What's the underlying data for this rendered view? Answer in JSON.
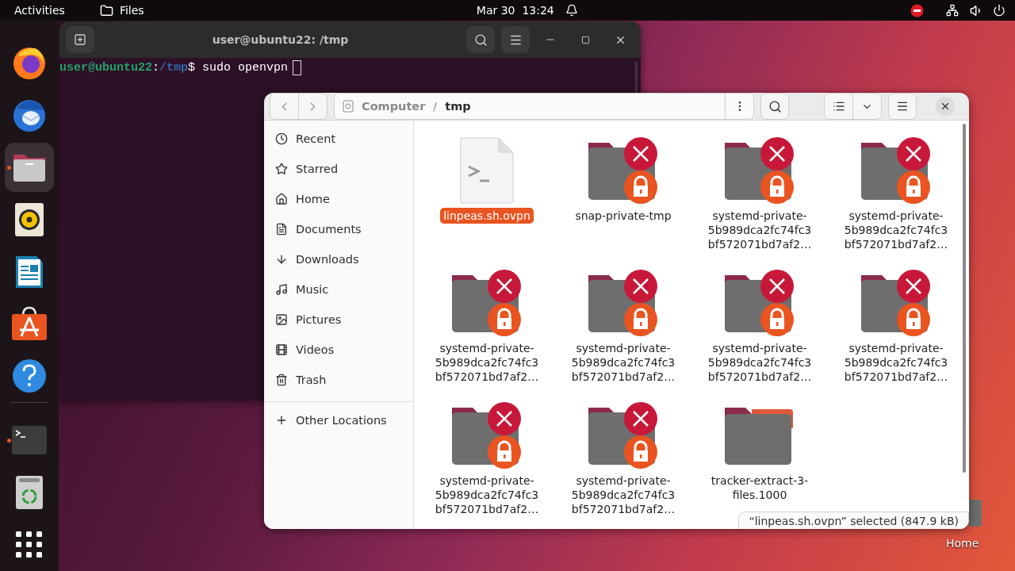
{
  "top_bar": {
    "activities": "Activities",
    "app_menu": "Files",
    "clock": "Mar 30  13:24"
  },
  "dock": {
    "favorites": [
      {
        "kind": "firefox",
        "running": false,
        "selected": false
      },
      {
        "kind": "mail",
        "running": false,
        "selected": false
      },
      {
        "kind": "files",
        "running": true,
        "selected": true
      },
      {
        "kind": "music",
        "running": false,
        "selected": false
      },
      {
        "kind": "writer",
        "running": false,
        "selected": false
      },
      {
        "kind": "store",
        "running": false,
        "selected": false
      },
      {
        "kind": "help",
        "running": false,
        "selected": false
      }
    ],
    "others": [
      {
        "kind": "terminal",
        "running": true,
        "selected": false
      },
      {
        "kind": "trash",
        "running": false,
        "selected": false
      },
      {
        "kind": "apps",
        "running": false,
        "selected": false
      }
    ]
  },
  "terminal": {
    "title": "user@ubuntu22: /tmp",
    "prompt": {
      "user": "user@ubuntu22",
      "colon": ":",
      "path": "/tmp",
      "dollar": "$",
      "command": " sudo openvpn"
    }
  },
  "files": {
    "path_bar": {
      "separator": "/",
      "segments": [
        {
          "label": "Computer",
          "selected": false
        },
        {
          "label": "tmp",
          "selected": true
        }
      ]
    },
    "sidebar": {
      "places": [
        {
          "label": "Recent"
        },
        {
          "label": "Starred"
        },
        {
          "label": "Home"
        },
        {
          "label": "Documents"
        },
        {
          "label": "Downloads"
        },
        {
          "label": "Music"
        },
        {
          "label": "Pictures"
        },
        {
          "label": "Videos"
        },
        {
          "label": "Trash"
        }
      ],
      "other": "Other Locations"
    },
    "items": [
      {
        "kind": "script",
        "selected": true,
        "lines": [
          "linpeas.sh.ovpn"
        ]
      },
      {
        "kind": "locked-folder",
        "selected": false,
        "lines": [
          "snap-private-tmp"
        ]
      },
      {
        "kind": "locked-folder",
        "selected": false,
        "lines": [
          "systemd-private-",
          "5b989dca2fc74fc3",
          "bf572071bd7af2…"
        ]
      },
      {
        "kind": "locked-folder",
        "selected": false,
        "lines": [
          "systemd-private-",
          "5b989dca2fc74fc3",
          "bf572071bd7af2…"
        ]
      },
      {
        "kind": "locked-folder",
        "selected": false,
        "lines": [
          "systemd-private-",
          "5b989dca2fc74fc3",
          "bf572071bd7af2…"
        ]
      },
      {
        "kind": "locked-folder",
        "selected": false,
        "lines": [
          "systemd-private-",
          "5b989dca2fc74fc3",
          "bf572071bd7af2…"
        ]
      },
      {
        "kind": "locked-folder",
        "selected": false,
        "lines": [
          "systemd-private-",
          "5b989dca2fc74fc3",
          "bf572071bd7af2…"
        ]
      },
      {
        "kind": "locked-folder",
        "selected": false,
        "lines": [
          "systemd-private-",
          "5b989dca2fc74fc3",
          "bf572071bd7af2…"
        ]
      },
      {
        "kind": "locked-folder",
        "selected": false,
        "lines": [
          "systemd-private-",
          "5b989dca2fc74fc3",
          "bf572071bd7af2…"
        ]
      },
      {
        "kind": "locked-folder",
        "selected": false,
        "lines": [
          "systemd-private-",
          "5b989dca2fc74fc3",
          "bf572071bd7af2…"
        ]
      },
      {
        "kind": "folder",
        "selected": false,
        "lines": [
          "tracker-extract-3-",
          "files.1000"
        ]
      }
    ],
    "status": "“linpeas.sh.ovpn” selected (847.9 kB)"
  },
  "desktop": {
    "icons": [
      {
        "label": "Home"
      }
    ]
  }
}
